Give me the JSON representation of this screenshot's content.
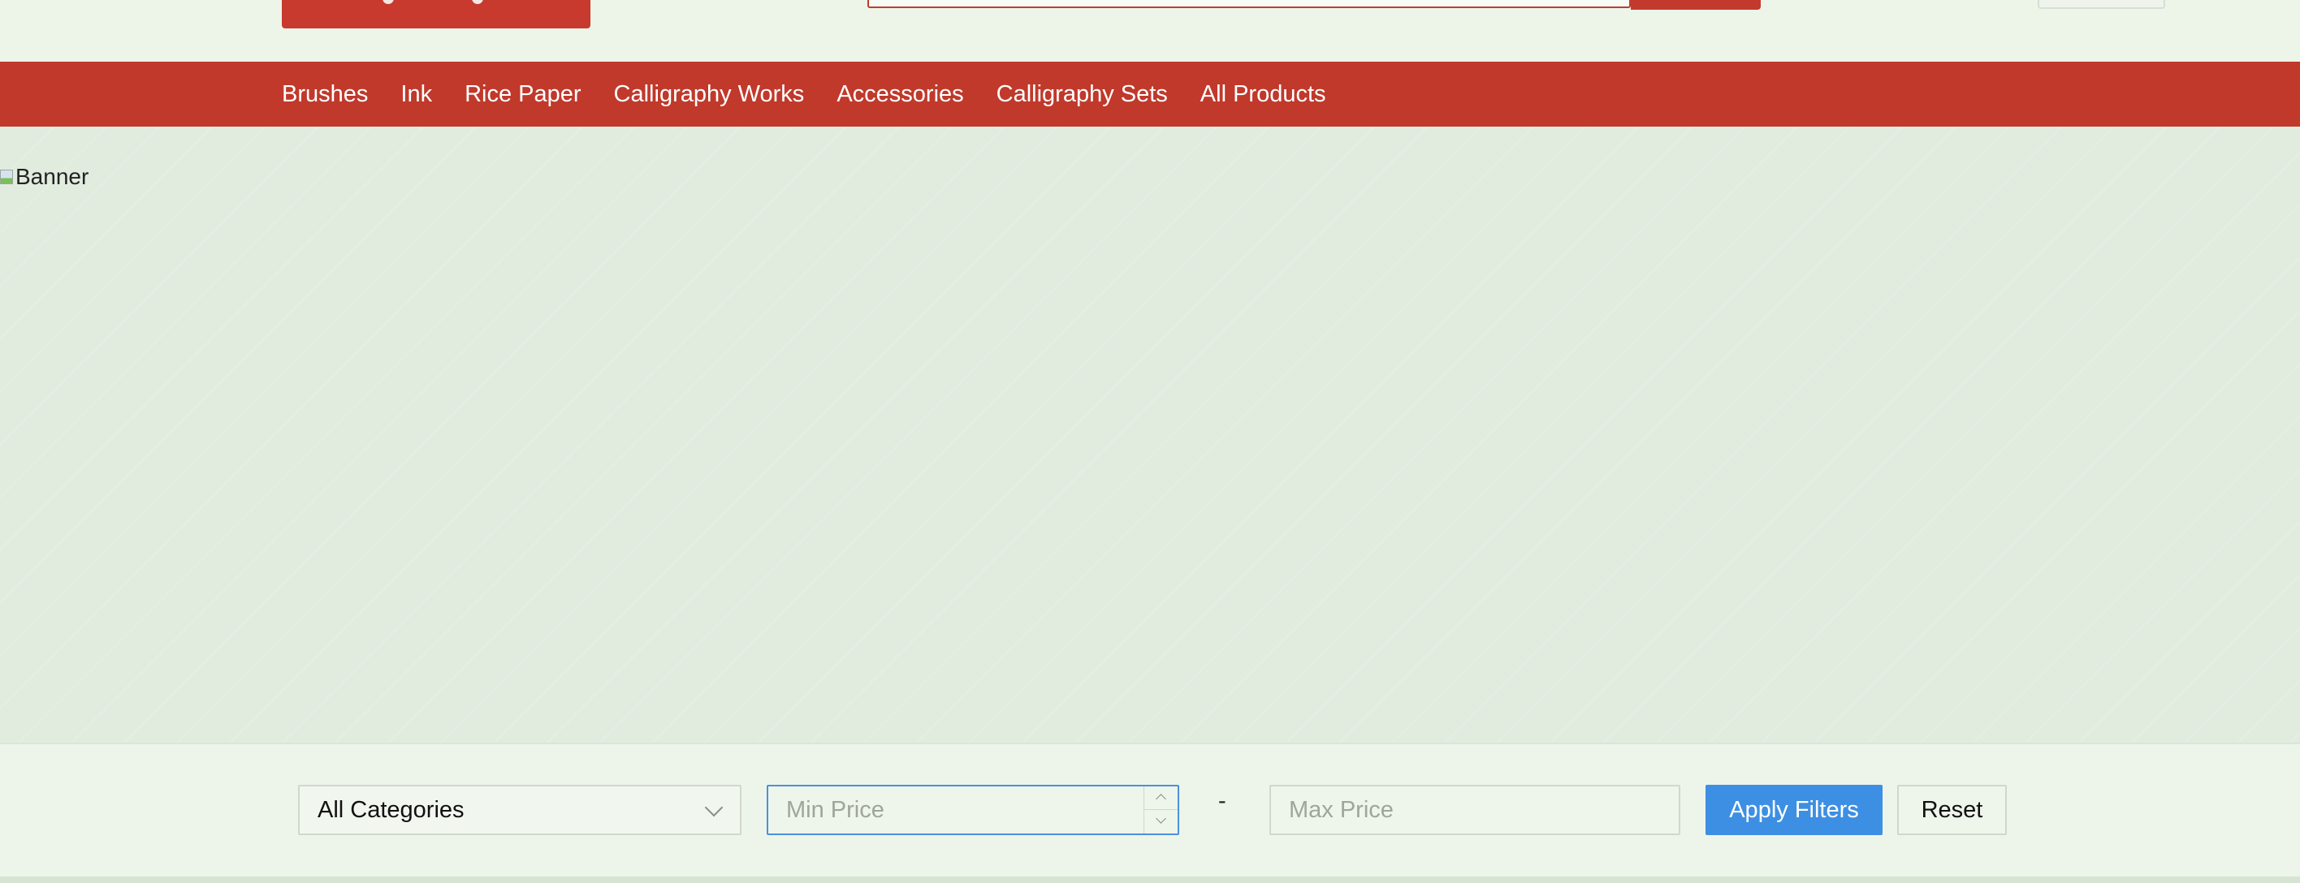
{
  "nav": {
    "items": [
      "Brushes",
      "Ink",
      "Rice Paper",
      "Calligraphy Works",
      "Accessories",
      "Calligraphy Sets",
      "All Products"
    ]
  },
  "banner": {
    "alt_text": "Banner"
  },
  "filters": {
    "category_selected": "All Categories",
    "min_price_placeholder": "Min Price",
    "range_separator": "-",
    "max_price_placeholder": "Max Price",
    "apply_label": "Apply Filters",
    "reset_label": "Reset"
  },
  "colors": {
    "brand_red": "#c0392b",
    "primary_blue": "#3d8fe3",
    "page_background": "#eef5ea"
  }
}
